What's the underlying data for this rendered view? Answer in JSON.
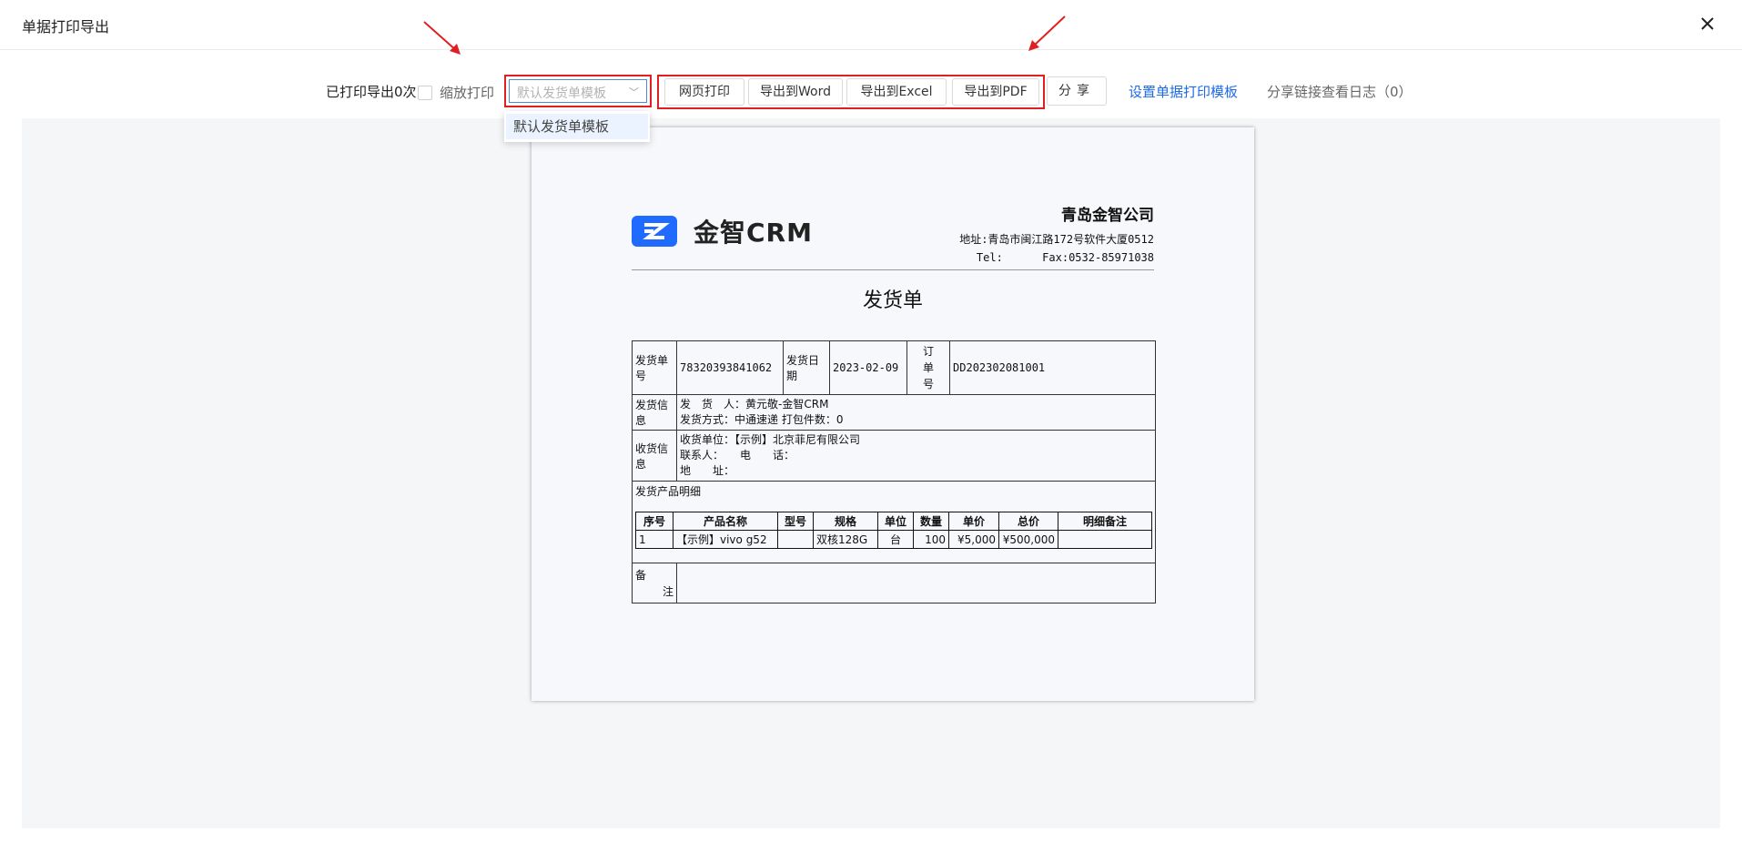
{
  "header": {
    "title": "单据打印导出"
  },
  "toolbar": {
    "print_count": "已打印导出0次",
    "scale_print": "缩放打印",
    "template_select": "默认发货单模板",
    "btn_web_print": "网页打印",
    "btn_word": "导出到Word",
    "btn_excel": "导出到Excel",
    "btn_pdf": "导出到PDF",
    "btn_share": "分享",
    "link_set_template": "设置单据打印模板",
    "link_share_log": "分享链接查看日志（0）"
  },
  "dropdown": {
    "options": [
      "默认发货单模板"
    ]
  },
  "doc": {
    "logo_text": "金智CRM",
    "company_name": "青岛金智公司",
    "address": "地址:青岛市闽江路172号软件大厦0512",
    "tel_fax": "Tel:      Fax:0532-85971038",
    "title": "发货单",
    "label_no": "发货单号",
    "value_no": "78320393841062",
    "label_date": "发货日期",
    "value_date": "2023-02-09",
    "label_order": "订单号",
    "value_order": "DD202302081001",
    "label_ship_info": "发货信息",
    "shipper": "发　货　人：黄元敬-金智CRM",
    "ship_method": "发货方式：中通速递 打包件数：0",
    "label_recv_info": "收货信息",
    "recv_unit": "收货单位：【示例】北京菲尼有限公司",
    "recv_contact": "联系人：　　电　　话：",
    "recv_addr": "地　　址：",
    "label_detail": "发货产品明细",
    "label_remark": "备注",
    "items_header": [
      "序号",
      "产品名称",
      "型号",
      "规格",
      "单位",
      "数量",
      "单价",
      "总价",
      "明细备注"
    ],
    "items": [
      [
        "1",
        "【示例】vivo g52",
        "",
        "双核128G",
        "台",
        "100",
        "¥5,000",
        "¥500,000",
        ""
      ]
    ]
  }
}
